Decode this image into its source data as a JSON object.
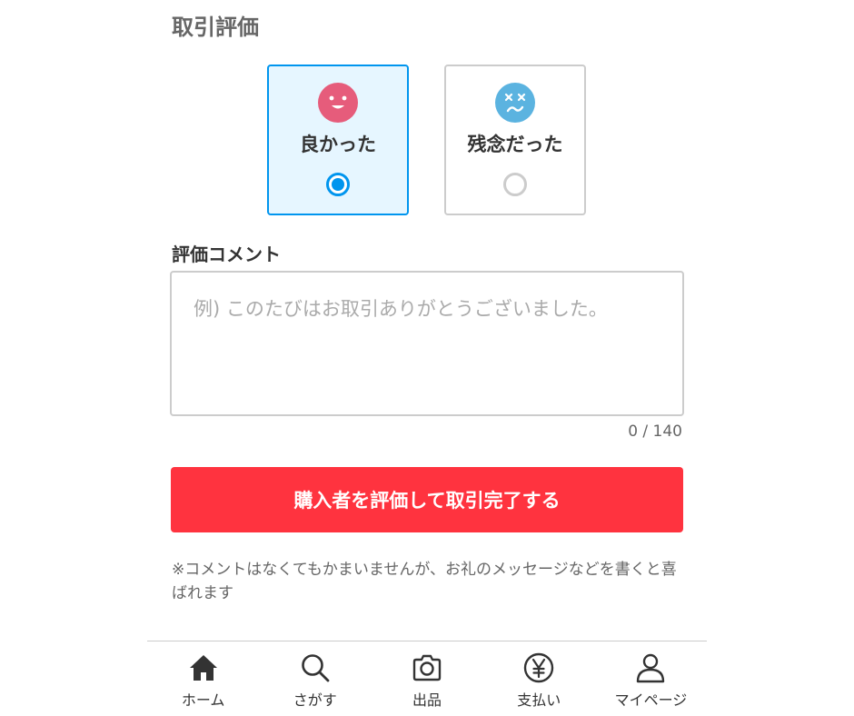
{
  "rating": {
    "title": "取引評価",
    "options": [
      {
        "label": "良かった",
        "icon": "smile-face-icon",
        "color": "#e65c7b",
        "selected": true
      },
      {
        "label": "残念だった",
        "icon": "sad-face-icon",
        "color": "#5bb3e0",
        "selected": false
      }
    ]
  },
  "comment": {
    "label": "評価コメント",
    "placeholder": "例) このたびはお取引ありがとうございました。",
    "value": "",
    "counter": "0 / 140"
  },
  "submit": {
    "label": "購入者を評価して取引完了する",
    "color": "#ff333f"
  },
  "note": "※コメントはなくてもかまいませんが、お礼のメッセージなどを書くと喜ばれます",
  "nav": {
    "items": [
      {
        "label": "ホーム",
        "icon": "home-icon"
      },
      {
        "label": "さがす",
        "icon": "search-icon"
      },
      {
        "label": "出品",
        "icon": "camera-icon"
      },
      {
        "label": "支払い",
        "icon": "yen-icon"
      },
      {
        "label": "マイページ",
        "icon": "person-icon"
      }
    ]
  },
  "colors": {
    "accent": "#0095ee",
    "selected_bg": "#e6f6ff",
    "border": "#cccccc"
  }
}
